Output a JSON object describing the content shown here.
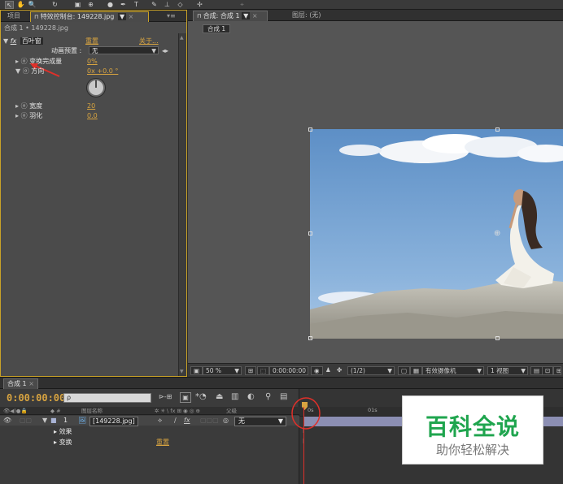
{
  "effect_panel": {
    "tab_project": "项目",
    "tab_effect_controls": "特效控制台: 149228.jpg",
    "layer_path": "合成 1 • 149228.jpg",
    "effect_name": "百叶窗",
    "reset_label": "重置",
    "about_label": "关于...",
    "preset_label": "动画预置 :",
    "preset_value": "无",
    "props": [
      {
        "label": "变换完成量",
        "value": "0%"
      },
      {
        "label": "方向",
        "value": "0x +0.0 °"
      },
      {
        "label": "宽度",
        "value": "20"
      },
      {
        "label": "羽化",
        "value": "0.0"
      }
    ]
  },
  "comp_panel": {
    "tab_comp": "合成: 合成 1",
    "tab_layer": "图层: (无)",
    "breadcrumb": "合成 1",
    "zoom": "50 %",
    "timecode": "0:00:00:00",
    "resolution": "(1/2)",
    "camera": "有效摄像机",
    "views": "1 视图"
  },
  "timeline": {
    "tab_comp": "合成 1",
    "timecode": "0:00:00:00",
    "col_source_name": "图层名称",
    "col_parent": "父级",
    "layer_index": "1",
    "layer_name": "[149228.jpg]",
    "parent_value": "无",
    "sub_effects": "效果",
    "sub_transform": "变换",
    "reset_label": "重置",
    "ruler_0": "0s",
    "ruler_1": "01s"
  },
  "watermark": {
    "title": "百科全说",
    "subtitle": "助你轻松解决"
  },
  "colors": {
    "accent_orange": "#d8a440",
    "panel_highlight": "#c9a227",
    "playhead": "#e0302a",
    "watermark_green": "#1fa54e"
  }
}
